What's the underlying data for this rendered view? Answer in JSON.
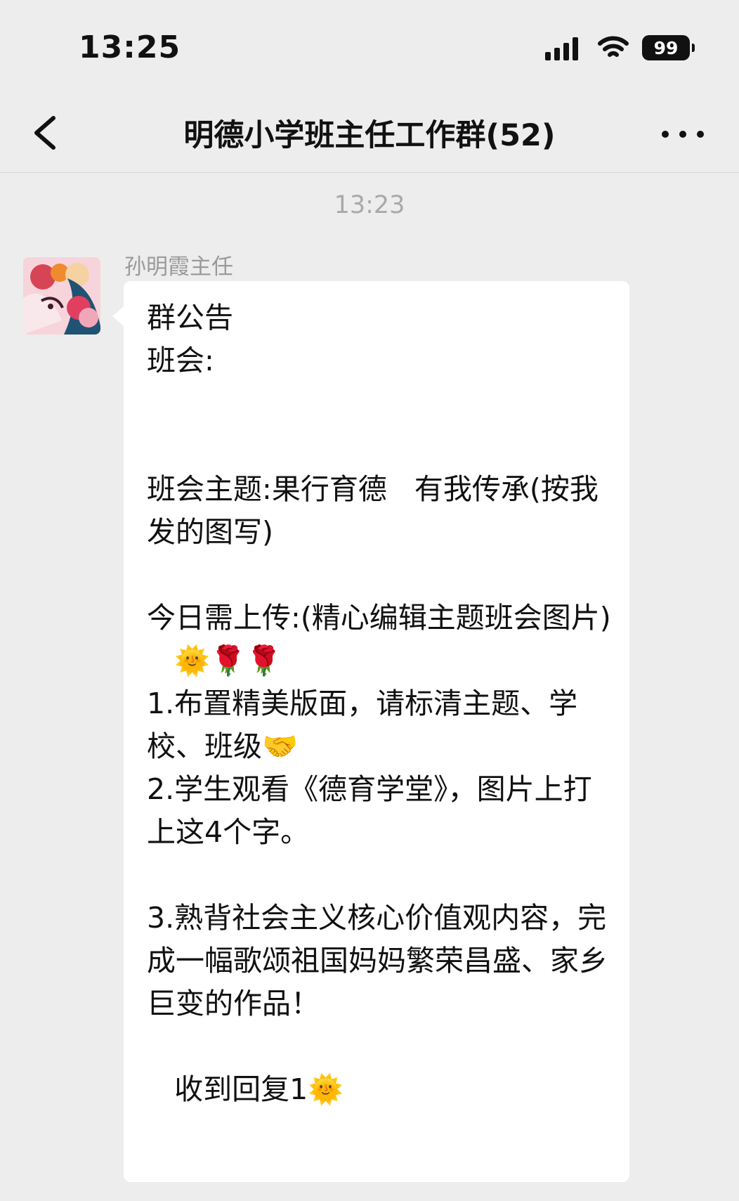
{
  "status_bar": {
    "time": "13:25",
    "battery_level": "99",
    "icons": [
      "signal-icon",
      "wifi-icon",
      "battery-icon"
    ]
  },
  "header": {
    "title": "明德小学班主任工作群(52)",
    "back_icon": "chevron-left-icon",
    "more_icon": "more-horizontal-icon"
  },
  "messages": [
    {
      "timestamp": "13:23",
      "sender": "孙明霞主任",
      "avatar": "avatar-image",
      "text": "群公告\n班会:\n\n\n班会主题:果行育德   有我传承(按我发的图写)\n\n今日需上传:(精心编辑主题班会图片)\n   🌞🌹🌹\n1.布置精美版面，请标清主题、学校、班级🤝\n2.学生观看《德育学堂》，图片上打上这4个字。\n\n3.熟背社会主义核心价值观内容，完成一幅歌颂祖国妈妈繁荣昌盛、家乡巨变的作品！\n\n   收到回复1🌞"
    }
  ],
  "colors": {
    "background": "#ededed",
    "bubble": "#ffffff",
    "timestamp": "#a9a9a9",
    "sender_name": "#9a9a9a"
  }
}
